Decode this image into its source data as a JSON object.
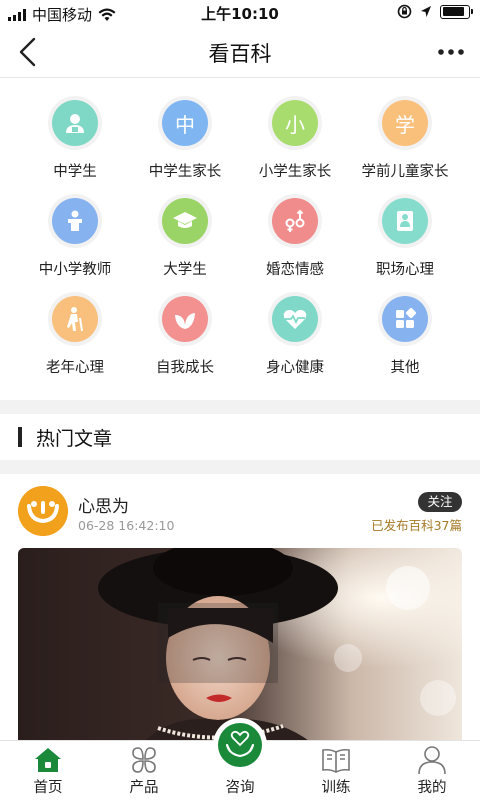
{
  "status_bar": {
    "carrier": "中国移动",
    "time": "上午10:10",
    "icons": [
      "signal-icon",
      "wifi-icon",
      "lock-rotation-icon",
      "location-icon",
      "battery-icon"
    ]
  },
  "nav": {
    "title": "看百科",
    "back_icon": "chevron-left-icon",
    "more_icon": "more-dots-icon"
  },
  "categories": [
    {
      "label": "中学生",
      "icon": "student-icon",
      "color": "#7fd8c6"
    },
    {
      "label": "中学生家长",
      "glyph": "中",
      "color": "#7fb6f2"
    },
    {
      "label": "小学生家长",
      "glyph": "小",
      "color": "#a8dc6f"
    },
    {
      "label": "学前儿童家长",
      "glyph": "学",
      "color": "#f9c07c"
    },
    {
      "label": "中小学教师",
      "icon": "teacher-podium-icon",
      "color": "#86b3f0"
    },
    {
      "label": "大学生",
      "icon": "graduation-cap-icon",
      "color": "#9bd466"
    },
    {
      "label": "婚恋情感",
      "icon": "gender-couple-icon",
      "color": "#f08c8c"
    },
    {
      "label": "职场心理",
      "icon": "businessman-icon",
      "color": "#86dccc"
    },
    {
      "label": "老年心理",
      "icon": "elderly-cane-icon",
      "color": "#f8c07c"
    },
    {
      "label": "自我成长",
      "icon": "sprout-leaf-icon",
      "color": "#f39090"
    },
    {
      "label": "身心健康",
      "icon": "heart-pulse-icon",
      "color": "#7fd8c8"
    },
    {
      "label": "其他",
      "icon": "grid-blocks-icon",
      "color": "#86b3f0"
    }
  ],
  "section": {
    "title": "热门文章"
  },
  "article": {
    "author": "心思为",
    "time": "06-28 16:42:10",
    "follow_label": "关注",
    "publish_info": "已发布百科37篇",
    "image_icon": "woman-veil-hat-photo"
  },
  "tabbar": {
    "items": [
      {
        "label": "首页",
        "icon": "home-icon",
        "active": true
      },
      {
        "label": "产品",
        "icon": "products-grid-icon"
      },
      {
        "label": "咨询",
        "icon": "consult-hands-heart-icon"
      },
      {
        "label": "训练",
        "icon": "book-icon"
      },
      {
        "label": "我的",
        "icon": "user-icon"
      }
    ],
    "active_color": "#1a8a3a"
  }
}
